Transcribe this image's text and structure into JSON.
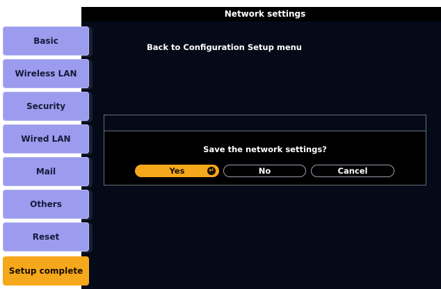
{
  "window": {
    "title": "Network settings"
  },
  "sidebar": {
    "items": [
      {
        "label": "Basic"
      },
      {
        "label": "Wireless LAN"
      },
      {
        "label": "Security"
      },
      {
        "label": "Wired LAN"
      },
      {
        "label": "Mail"
      },
      {
        "label": "Others"
      },
      {
        "label": "Reset"
      },
      {
        "label": "Setup complete"
      }
    ],
    "active_index": 7
  },
  "main": {
    "back_link": "Back to Configuration Setup menu"
  },
  "dialog": {
    "message": "Save the network settings?",
    "buttons": [
      {
        "label": "Yes",
        "selected": true,
        "icon": "enter-icon"
      },
      {
        "label": "No"
      },
      {
        "label": "Cancel"
      }
    ]
  },
  "colors": {
    "accent": "#f6a81c",
    "sidebar": "#9c9cee",
    "panel": "#040a18"
  }
}
